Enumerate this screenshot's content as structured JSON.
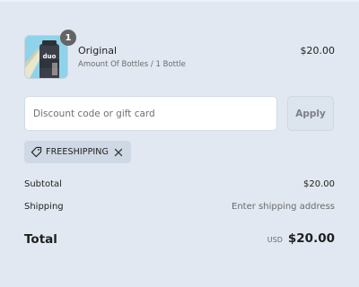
{
  "product": {
    "quantity_badge": "1",
    "name": "Original",
    "variant": "Amount Of Bottles / 1 Bottle",
    "price": "$20.00",
    "thumbnail_icon": "product-bottle-image",
    "thumbnail_text": "duo"
  },
  "discount": {
    "placeholder": "Discount code or gift card",
    "value": "",
    "apply_label": "Apply"
  },
  "applied_code": {
    "icon": "tag-icon",
    "label": "FREESHIPPING",
    "remove_icon": "close-icon"
  },
  "summary": {
    "subtotal_label": "Subtotal",
    "subtotal_value": "$20.00",
    "shipping_label": "Shipping",
    "shipping_value": "Enter shipping address",
    "total_label": "Total",
    "currency": "USD",
    "total_value": "$20.00"
  },
  "colors": {
    "background": "#e1e8f1",
    "badge": "#646464",
    "chip": "#cfd9e5",
    "apply_button": "#dce4ee"
  }
}
